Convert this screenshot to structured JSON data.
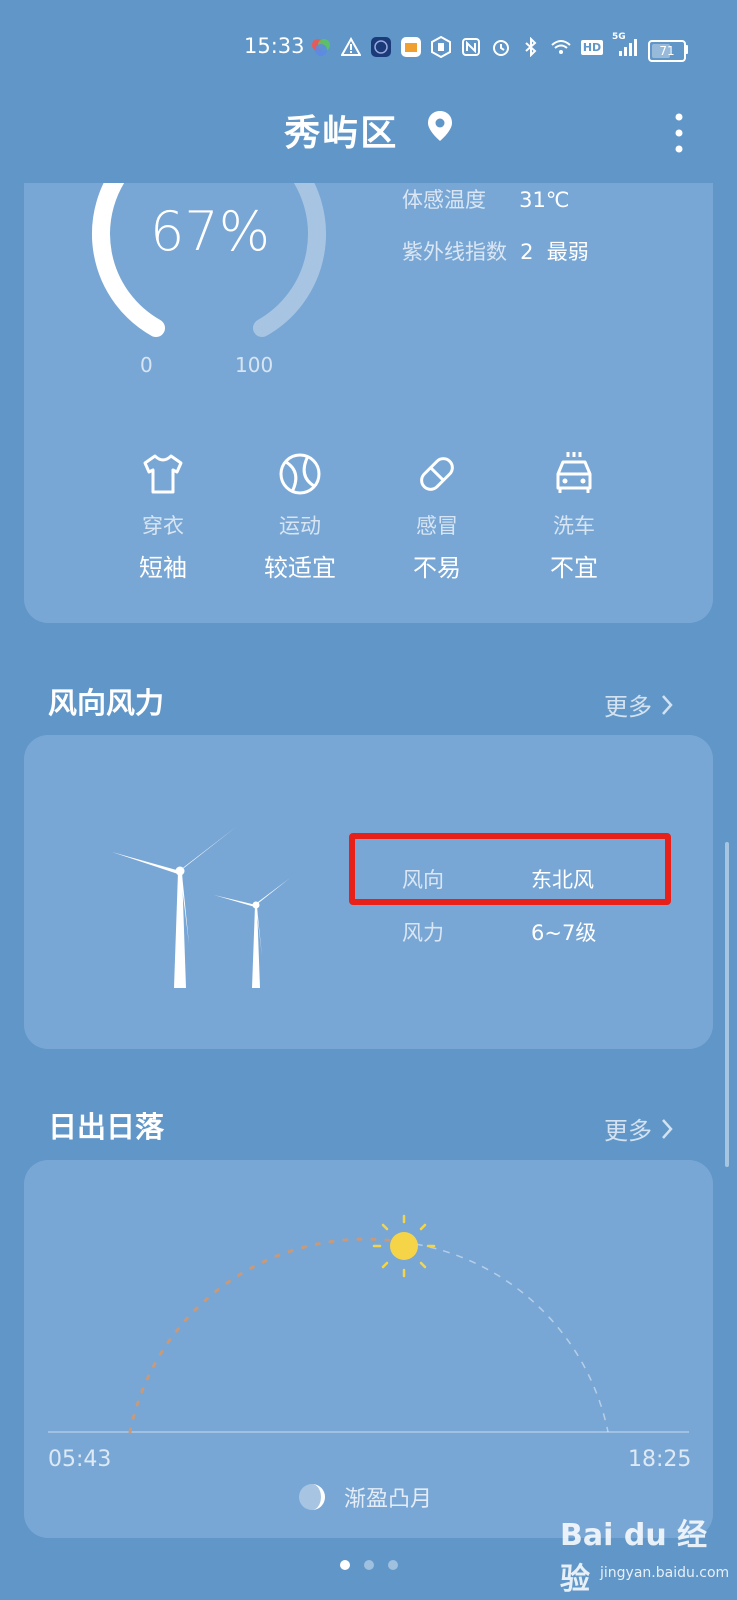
{
  "status_bar": {
    "time": "15:33",
    "icons": [
      "app-icon",
      "warning-icon",
      "face-icon",
      "mail-icon",
      "hand-icon",
      "nfc-icon",
      "alarm-icon",
      "bluetooth-icon",
      "wifi-icon",
      "hd-icon",
      "signal-5g-icon"
    ],
    "hd_label": "HD",
    "net_label": "5G",
    "battery": "71",
    "battery_level": 0.71
  },
  "header": {
    "city": "秀屿区"
  },
  "humidity": {
    "value": "67%",
    "level": 0.67,
    "min_label": "0",
    "max_label": "100"
  },
  "details": [
    {
      "label": "体感温度",
      "value": "31℃"
    },
    {
      "label": "紫外线指数",
      "value": "2  最弱"
    }
  ],
  "life_index": [
    {
      "icon": "shirt-icon",
      "label": "穿衣",
      "value": "短袖"
    },
    {
      "icon": "ball-icon",
      "label": "运动",
      "value": "较适宜"
    },
    {
      "icon": "pill-icon",
      "label": "感冒",
      "value": "不易"
    },
    {
      "icon": "car-wash-icon",
      "label": "洗车",
      "value": "不宜"
    }
  ],
  "wind": {
    "title": "风向风力",
    "more": "更多",
    "direction_label": "风向",
    "direction_value": "东北风",
    "force_label": "风力",
    "force_value": "6~7级"
  },
  "sun": {
    "title": "日出日落",
    "more": "更多",
    "sunrise": "05:43",
    "sunset": "18:25",
    "moon_phase": "渐盈凸月"
  },
  "pager": {
    "count": 3,
    "active": 0
  },
  "watermark": {
    "brand": "Bai du 经验",
    "url": "jingyan.baidu.com"
  },
  "colors": {
    "background": "#6096c8",
    "card": "#79a7d5",
    "highlight": "#e8201a",
    "sun": "#f5d547",
    "sunrise_path": "#c89a7a"
  }
}
